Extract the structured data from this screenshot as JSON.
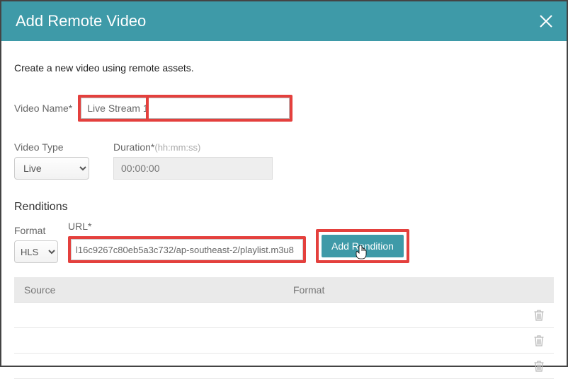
{
  "header": {
    "title": "Add Remote Video"
  },
  "intro": "Create a new video using remote assets.",
  "name": {
    "label": "Video Name*",
    "value": "Live Stream 1"
  },
  "type": {
    "label": "Video Type",
    "value": "Live"
  },
  "duration": {
    "label": "Duration*",
    "hint": "(hh:mm:ss)",
    "placeholder": "00:00:00"
  },
  "renditions": {
    "title": "Renditions",
    "format_label": "Format",
    "format_value": "HLS",
    "url_label": "URL*",
    "url_value": "l16c9267c80eb5a3c732/ap-southeast-2/playlist.m3u8",
    "button": "Add Rendition",
    "columns": {
      "source": "Source",
      "format": "Format"
    }
  },
  "icons": {
    "close": "close-icon",
    "trash": "trash-icon",
    "cursor": "pointer-cursor"
  }
}
